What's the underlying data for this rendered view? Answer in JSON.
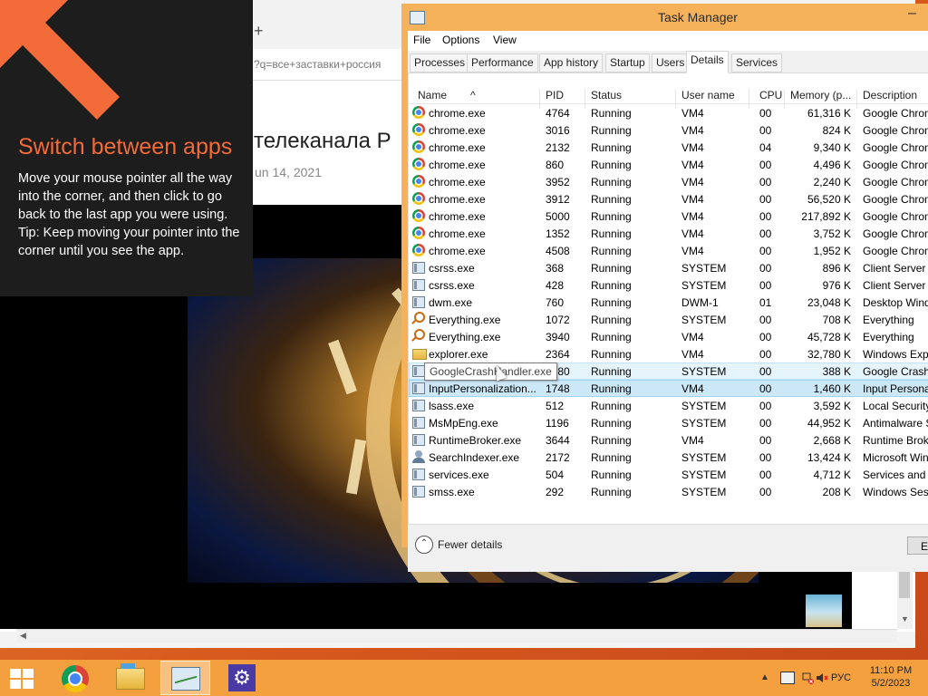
{
  "browser": {
    "url_fragment": "?q=все+заставки+россия",
    "page_title": "телеканала Р",
    "page_date": "un 14, 2021",
    "new_tab_glyph": "+"
  },
  "tip": {
    "title": "Switch between apps",
    "line1": "Move your mouse pointer all the way into the corner, and then click to go back to the last app you were using.",
    "line2": "Tip: Keep moving your pointer into the corner until you see the app."
  },
  "taskmanager": {
    "title": "Task Manager",
    "minimize_glyph": "–",
    "menu": [
      "File",
      "Options",
      "View"
    ],
    "tabs": [
      "Processes",
      "Performance",
      "App history",
      "Startup",
      "Users",
      "Details",
      "Services"
    ],
    "active_tab": "Details",
    "columns": [
      "Name",
      "PID",
      "Status",
      "User name",
      "CPU",
      "Memory (p...",
      "Description"
    ],
    "rows": [
      {
        "icon": "chrome-icon",
        "name": "chrome.exe",
        "pid": "4764",
        "status": "Running",
        "user": "VM4",
        "cpu": "00",
        "mem": "61,316 K",
        "desc": "Google Chrome"
      },
      {
        "icon": "chrome-icon",
        "name": "chrome.exe",
        "pid": "3016",
        "status": "Running",
        "user": "VM4",
        "cpu": "00",
        "mem": "824 K",
        "desc": "Google Chrome"
      },
      {
        "icon": "chrome-icon",
        "name": "chrome.exe",
        "pid": "2132",
        "status": "Running",
        "user": "VM4",
        "cpu": "04",
        "mem": "9,340 K",
        "desc": "Google Chrome"
      },
      {
        "icon": "chrome-icon",
        "name": "chrome.exe",
        "pid": "860",
        "status": "Running",
        "user": "VM4",
        "cpu": "00",
        "mem": "4,496 K",
        "desc": "Google Chrome"
      },
      {
        "icon": "chrome-icon",
        "name": "chrome.exe",
        "pid": "3952",
        "status": "Running",
        "user": "VM4",
        "cpu": "00",
        "mem": "2,240 K",
        "desc": "Google Chrome"
      },
      {
        "icon": "chrome-icon",
        "name": "chrome.exe",
        "pid": "3912",
        "status": "Running",
        "user": "VM4",
        "cpu": "00",
        "mem": "56,520 K",
        "desc": "Google Chrome"
      },
      {
        "icon": "chrome-icon",
        "name": "chrome.exe",
        "pid": "5000",
        "status": "Running",
        "user": "VM4",
        "cpu": "00",
        "mem": "217,892 K",
        "desc": "Google Chrome"
      },
      {
        "icon": "chrome-icon",
        "name": "chrome.exe",
        "pid": "1352",
        "status": "Running",
        "user": "VM4",
        "cpu": "00",
        "mem": "3,752 K",
        "desc": "Google Chrome"
      },
      {
        "icon": "chrome-icon",
        "name": "chrome.exe",
        "pid": "4508",
        "status": "Running",
        "user": "VM4",
        "cpu": "00",
        "mem": "1,952 K",
        "desc": "Google Chrome"
      },
      {
        "icon": "window-icon",
        "name": "csrss.exe",
        "pid": "368",
        "status": "Running",
        "user": "SYSTEM",
        "cpu": "00",
        "mem": "896 K",
        "desc": "Client Server Runtime"
      },
      {
        "icon": "window-icon",
        "name": "csrss.exe",
        "pid": "428",
        "status": "Running",
        "user": "SYSTEM",
        "cpu": "00",
        "mem": "976 K",
        "desc": "Client Server Runtime"
      },
      {
        "icon": "window-icon",
        "name": "dwm.exe",
        "pid": "760",
        "status": "Running",
        "user": "DWM-1",
        "cpu": "01",
        "mem": "23,048 K",
        "desc": "Desktop Window Manager"
      },
      {
        "icon": "magnify-icon",
        "name": "Everything.exe",
        "pid": "1072",
        "status": "Running",
        "user": "SYSTEM",
        "cpu": "00",
        "mem": "708 K",
        "desc": "Everything"
      },
      {
        "icon": "magnify-icon",
        "name": "Everything.exe",
        "pid": "3940",
        "status": "Running",
        "user": "VM4",
        "cpu": "00",
        "mem": "45,728 K",
        "desc": "Everything"
      },
      {
        "icon": "folder-icon",
        "name": "explorer.exe",
        "pid": "2364",
        "status": "Running",
        "user": "VM4",
        "cpu": "00",
        "mem": "32,780 K",
        "desc": "Windows Explorer"
      },
      {
        "icon": "window-icon",
        "name": "GoogleCrashHandler.exe",
        "pid": "3080",
        "status": "Running",
        "user": "SYSTEM",
        "cpu": "00",
        "mem": "388 K",
        "desc": "Google Crash Handler"
      },
      {
        "icon": "window-icon",
        "name": "InputPersonalization...",
        "pid": "1748",
        "status": "Running",
        "user": "VM4",
        "cpu": "00",
        "mem": "1,460 K",
        "desc": "Input Personalization"
      },
      {
        "icon": "window-icon",
        "name": "lsass.exe",
        "pid": "512",
        "status": "Running",
        "user": "SYSTEM",
        "cpu": "00",
        "mem": "3,592 K",
        "desc": "Local Security Authority"
      },
      {
        "icon": "window-icon",
        "name": "MsMpEng.exe",
        "pid": "1196",
        "status": "Running",
        "user": "SYSTEM",
        "cpu": "00",
        "mem": "44,952 K",
        "desc": "Antimalware Service"
      },
      {
        "icon": "window-icon",
        "name": "RuntimeBroker.exe",
        "pid": "3644",
        "status": "Running",
        "user": "VM4",
        "cpu": "00",
        "mem": "2,668 K",
        "desc": "Runtime Broker"
      },
      {
        "icon": "user-icon",
        "name": "SearchIndexer.exe",
        "pid": "2172",
        "status": "Running",
        "user": "SYSTEM",
        "cpu": "00",
        "mem": "13,424 K",
        "desc": "Microsoft Windows Search"
      },
      {
        "icon": "window-icon",
        "name": "services.exe",
        "pid": "504",
        "status": "Running",
        "user": "SYSTEM",
        "cpu": "00",
        "mem": "4,712 K",
        "desc": "Services and Controller"
      },
      {
        "icon": "window-icon",
        "name": "smss.exe",
        "pid": "292",
        "status": "Running",
        "user": "SYSTEM",
        "cpu": "00",
        "mem": "208 K",
        "desc": "Windows Session Manager"
      }
    ],
    "hover_row": 15,
    "selected_row": 16,
    "tooltip": "GoogleCrashHandler.exe",
    "fewer_details": "Fewer details",
    "fewer_glyph": "⌃",
    "end_task_partial": "E"
  },
  "taskbar": {
    "items": [
      "start",
      "chrome",
      "file-explorer",
      "task-manager",
      "settings"
    ],
    "active_item": "task-manager",
    "language": "РУС",
    "time": "11:10 PM",
    "date": "5/2/2023",
    "settings_glyph": "⚙",
    "tray_expand_glyph": "▲"
  },
  "colors": {
    "accent_orange": "#f26b38",
    "taskbar": "#f5a03e",
    "tm_frame": "#f6b25a",
    "selection": "#cce8f6"
  }
}
